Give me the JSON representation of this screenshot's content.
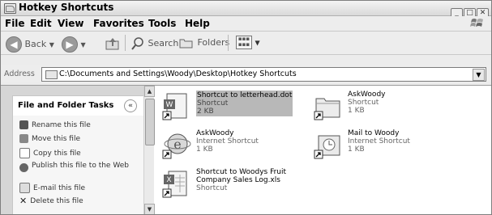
{
  "window": {
    "title": "Hotkey Shortcuts"
  },
  "menu": [
    "File",
    "Edit",
    "View",
    "Favorites",
    "Tools",
    "Help"
  ],
  "toolbar": {
    "back_label": "Back",
    "search_label": "Search",
    "folders_label": "Folders"
  },
  "address": {
    "label": "Address",
    "path": "C:\\Documents and Settings\\Woody\\Desktop\\Hotkey Shortcuts"
  },
  "tasks": {
    "header": "File and Folder Tasks",
    "items": [
      {
        "label": "Rename this file",
        "icon": "rename-icon"
      },
      {
        "label": "Move this file",
        "icon": "move-icon"
      },
      {
        "label": "Copy this file",
        "icon": "copy-icon"
      },
      {
        "label": "Publish this file to the Web",
        "icon": "globe-icon"
      },
      {
        "label": "E-mail this file",
        "icon": "email-icon"
      },
      {
        "label": "Delete this file",
        "icon": "delete-icon"
      }
    ]
  },
  "files": [
    {
      "name": "Shortcut to letterhead.dot",
      "type": "Shortcut",
      "size": "2 KB",
      "selected": true,
      "icon": "word-doc-shortcut-icon"
    },
    {
      "name": "AskWoody",
      "type": "Shortcut",
      "size": "1 KB",
      "icon": "folder-shortcut-icon"
    },
    {
      "name": "AskWoody",
      "type": "Internet Shortcut",
      "size": "1 KB",
      "icon": "internet-shortcut-icon"
    },
    {
      "name": "Mail to Woody",
      "type": "Internet Shortcut",
      "size": "1 KB",
      "icon": "mail-shortcut-icon"
    },
    {
      "name": "Shortcut to Woodys Fruit Company Sales Log.xls",
      "name_line1": "Shortcut to Woodys Fruit",
      "name_line2": "Company Sales Log.xls",
      "type": "Shortcut",
      "icon": "excel-shortcut-icon"
    }
  ]
}
